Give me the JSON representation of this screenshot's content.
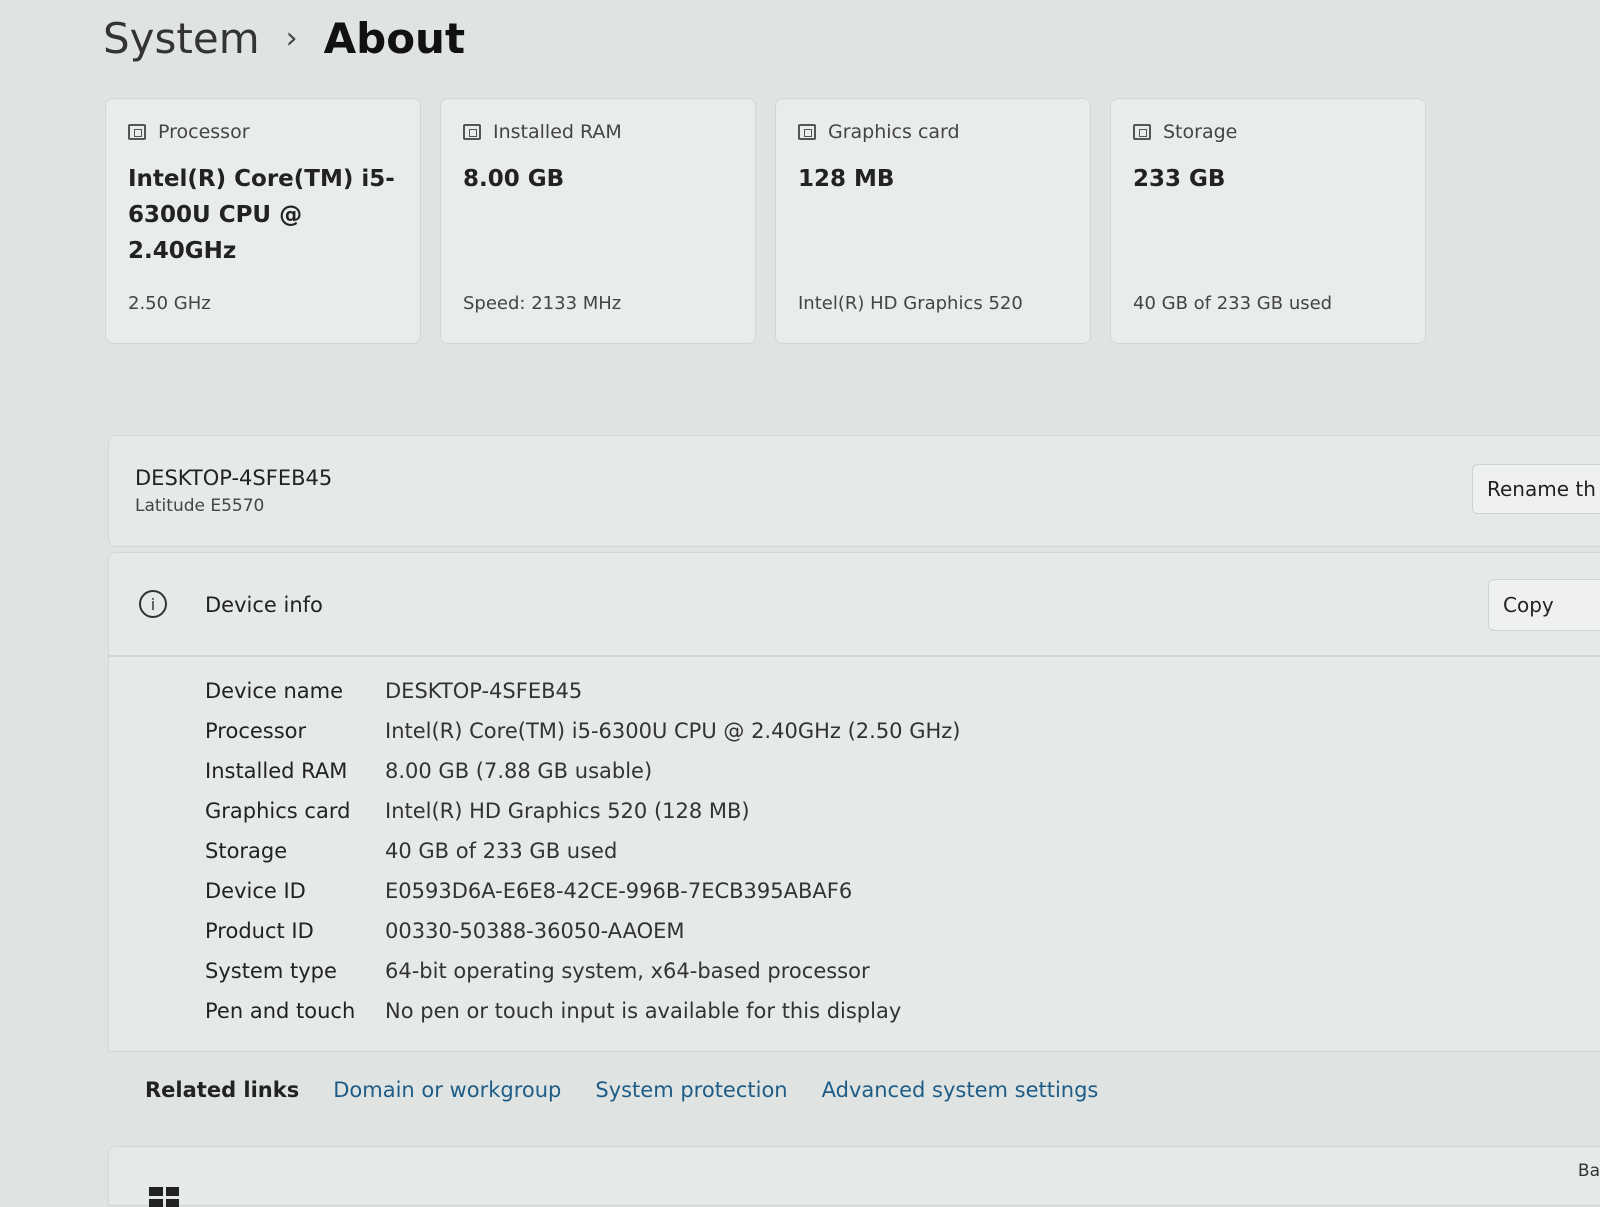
{
  "breadcrumb": {
    "parent": "System",
    "separator": "›",
    "current": "About"
  },
  "specs": [
    {
      "label": "Processor",
      "value": "Intel(R) Core(TM) i5-6300U CPU @ 2.40GHz",
      "sub": "2.50 GHz",
      "icon": "processor-icon"
    },
    {
      "label": "Installed RAM",
      "value": "8.00 GB",
      "sub": "Speed: 2133 MHz",
      "icon": "ram-icon"
    },
    {
      "label": "Graphics card",
      "value": "128 MB",
      "sub": "Intel(R) HD Graphics 520",
      "icon": "graphics-card-icon"
    },
    {
      "label": "Storage",
      "value": "233 GB",
      "sub": "40 GB of 233 GB used",
      "icon": "storage-icon"
    }
  ],
  "device": {
    "name": "DESKTOP-4SFEB45",
    "model": "Latitude E5570",
    "rename_label": "Rename th"
  },
  "device_info": {
    "title": "Device info",
    "copy_label": "Copy",
    "rows": [
      {
        "key": "Device name",
        "value": "DESKTOP-4SFEB45"
      },
      {
        "key": "Processor",
        "value": "Intel(R) Core(TM) i5-6300U CPU @ 2.40GHz (2.50 GHz)"
      },
      {
        "key": "Installed RAM",
        "value": "8.00 GB (7.88 GB usable)"
      },
      {
        "key": "Graphics card",
        "value": "Intel(R) HD Graphics 520 (128 MB)"
      },
      {
        "key": "Storage",
        "value": "40 GB of 233 GB used"
      },
      {
        "key": "Device ID",
        "value": "E0593D6A-E6E8-42CE-996B-7ECB395ABAF6"
      },
      {
        "key": "Product ID",
        "value": "00330-50388-36050-AAOEM"
      },
      {
        "key": "System type",
        "value": "64-bit operating system, x64-based processor"
      },
      {
        "key": "Pen and touch",
        "value": "No pen or touch input is available for this display"
      }
    ]
  },
  "related": {
    "label": "Related links",
    "links": [
      "Domain or workgroup",
      "System protection",
      "Advanced system settings"
    ]
  },
  "windows_section": {
    "right_text": "Ba"
  }
}
